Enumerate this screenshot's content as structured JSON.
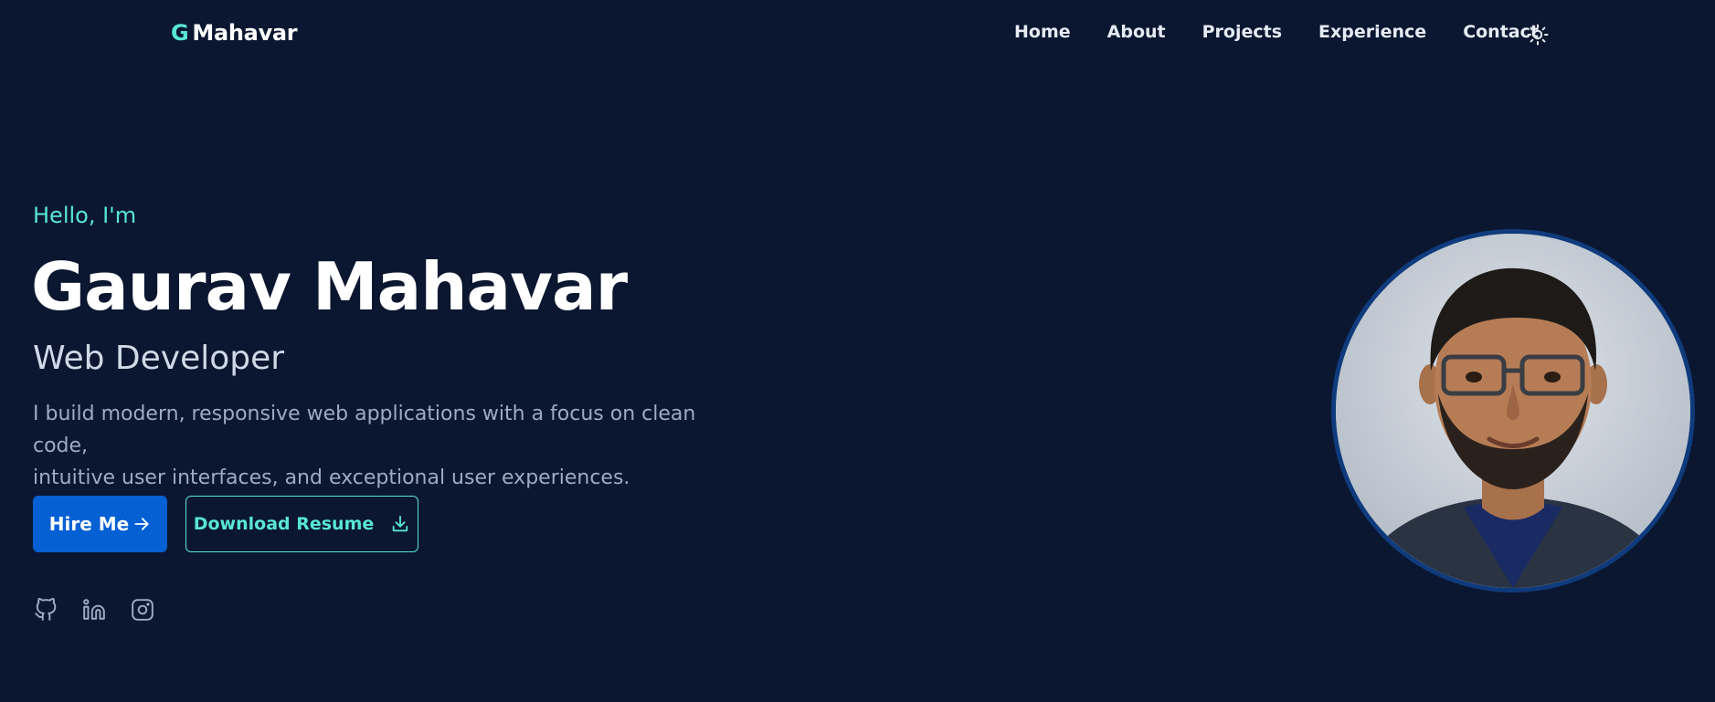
{
  "header": {
    "logo_mark": "G",
    "logo_text": "Mahavar",
    "nav": [
      "Home",
      "About",
      "Projects",
      "Experience",
      "Contact"
    ],
    "theme_icon": "sun-icon"
  },
  "hero": {
    "greeting": "Hello, I'm",
    "name": "Gaurav Mahavar",
    "role": "Web Developer",
    "description_line1": "I build modern, responsive web applications with a focus on clean code,",
    "description_line2": "intuitive user interfaces, and exceptional user experiences.",
    "hire_label": "Hire Me",
    "hire_icon": "arrow-right-icon",
    "resume_label": "Download Resume",
    "resume_icon": "download-icon",
    "socials": [
      "github-icon",
      "linkedin-icon",
      "instagram-icon"
    ],
    "avatar": "profile-photo"
  },
  "colors": {
    "background": "#0b1730",
    "accent": "#58e6d4",
    "primary_button": "#0560d4",
    "avatar_border": "#0f3b7d"
  }
}
